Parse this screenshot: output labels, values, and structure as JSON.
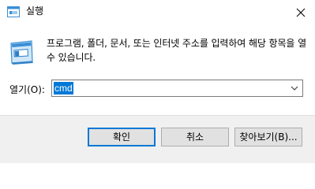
{
  "window": {
    "title": "실행",
    "description": "프로그램, 폴더, 문서, 또는 인터넷 주소를 입력하여 해당 항목을 열 수 있습니다.",
    "open_label": "열기(O):",
    "command_value": "cmd",
    "icons": {
      "app": "run-dialog-icon",
      "close": "close-icon",
      "dropdown": "chevron-down-icon"
    },
    "colors": {
      "selection": "#0078d7",
      "footer": "#f0f0f0",
      "button": "#e1e1e1"
    }
  },
  "buttons": {
    "ok": "확인",
    "cancel": "취소",
    "browse": "찾아보기(B)..."
  }
}
